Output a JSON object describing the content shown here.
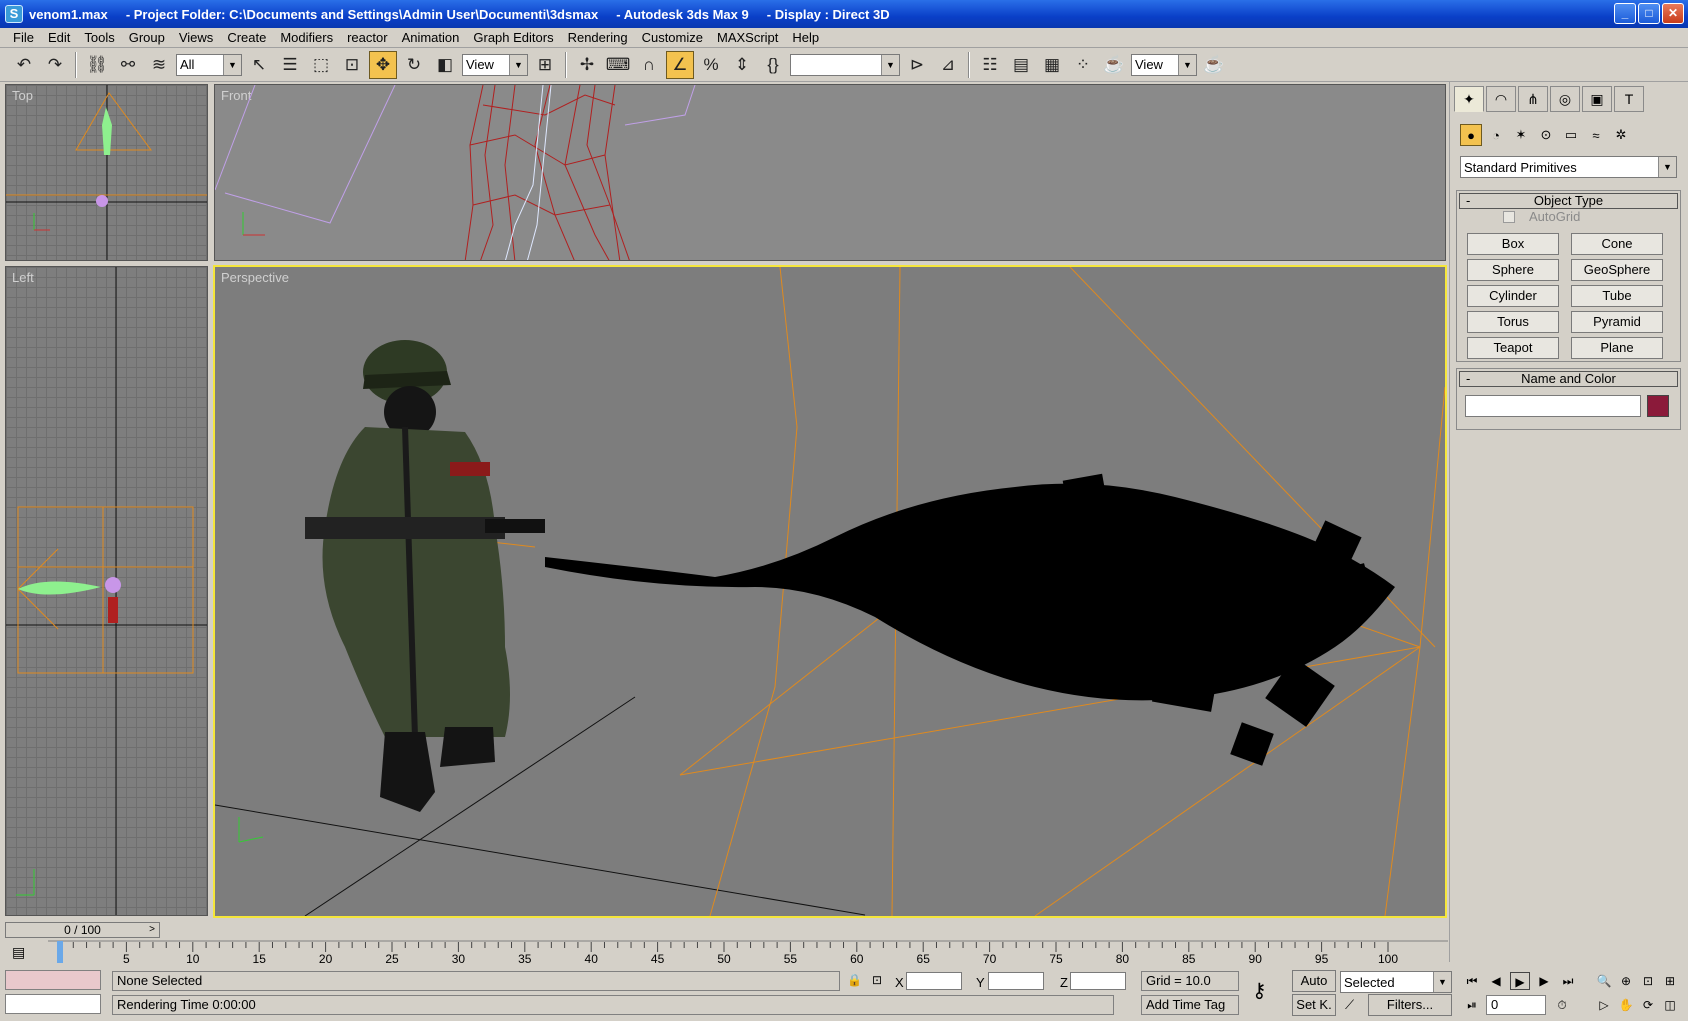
{
  "window": {
    "title": "venom1.max     - Project Folder: C:\\Documents and Settings\\Admin User\\Documenti\\3dsmax     - Autodesk 3ds Max 9     - Display : Direct 3D",
    "app_icon": "3dsmax-logo-icon"
  },
  "menu": [
    "File",
    "Edit",
    "Tools",
    "Group",
    "Views",
    "Create",
    "Modifiers",
    "reactor",
    "Animation",
    "Graph Editors",
    "Rendering",
    "Customize",
    "MAXScript",
    "Help"
  ],
  "toolbar": {
    "selection_filter": "All",
    "reference_coord": "View",
    "named_selection": "",
    "render_type": "View"
  },
  "viewports": {
    "top": "Top",
    "front": "Front",
    "left": "Left",
    "perspective": "Perspective"
  },
  "command_panel": {
    "primitive_type": "Standard Primitives",
    "object_type_title": "Object Type",
    "autogrid_label": "AutoGrid",
    "object_buttons": [
      "Box",
      "Cone",
      "Sphere",
      "GeoSphere",
      "Cylinder",
      "Tube",
      "Torus",
      "Pyramid",
      "Teapot",
      "Plane"
    ],
    "name_color_title": "Name and Color",
    "object_name": "",
    "object_color": "#8b1a3a"
  },
  "timeline": {
    "slider_label": "0 / 100",
    "ticks": [
      "5",
      "10",
      "15",
      "20",
      "25",
      "30",
      "35",
      "40",
      "45",
      "50",
      "55",
      "60",
      "65",
      "70",
      "75",
      "80",
      "85",
      "90",
      "95",
      "100"
    ]
  },
  "status": {
    "selection": "None Selected",
    "prompt": "Rendering Time  0:00:00",
    "x_label": "X",
    "y_label": "Y",
    "z_label": "Z",
    "grid": "Grid = 10.0",
    "auto_key": "Auto",
    "set_key": "Set K.",
    "key_filter": "Selected",
    "add_time_tag": "Add Time Tag",
    "filters": "Filters...",
    "current_frame": "0"
  },
  "colors": {
    "titlebar": "#0a3fc8",
    "ui_bg": "#d4d0c8",
    "active_viewport_border": "#f5e63a",
    "active_tool": "#f3c24f",
    "light_wireframe": "#e08a1e",
    "wireframe_red": "#b02020"
  }
}
